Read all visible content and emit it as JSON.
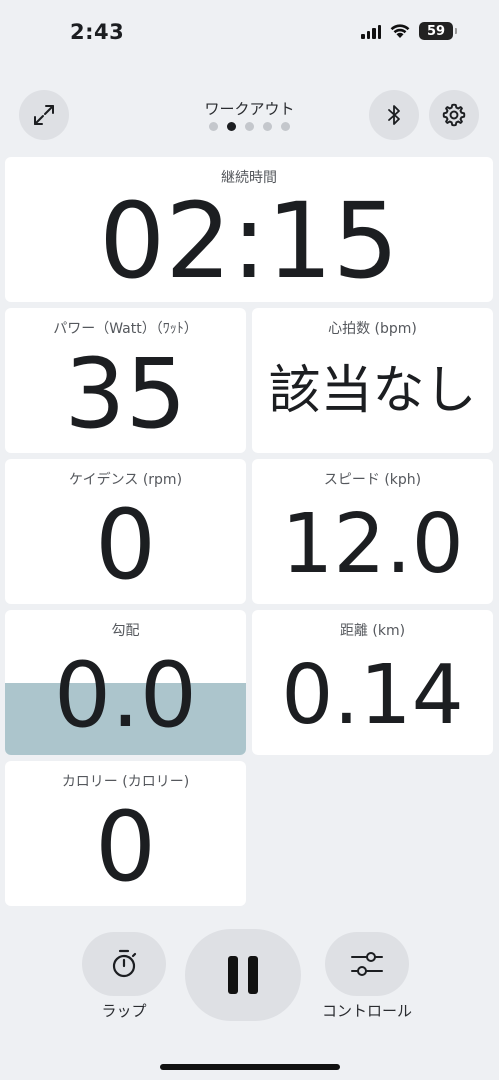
{
  "status_bar": {
    "time": "2:43",
    "battery": "59",
    "icons": [
      "signal-icon",
      "wifi-icon",
      "battery-icon"
    ]
  },
  "header": {
    "title": "ワークアウト",
    "page_count": 5,
    "active_page": 2,
    "left_button_icon": "expand-icon",
    "right_button_icons": [
      "bluetooth-icon",
      "gear-icon"
    ]
  },
  "metrics": {
    "duration": {
      "label": "継続時間",
      "value": "02:15"
    },
    "power": {
      "label": "パワー（Watt）（ﾜｯﾄ）",
      "value": "35"
    },
    "heart_rate": {
      "label": "心拍数 (bpm)",
      "value": "該当なし"
    },
    "cadence": {
      "label": "ケイデンス (rpm)",
      "value": "0"
    },
    "speed": {
      "label": "スピード (kph)",
      "value": "12.0"
    },
    "incline": {
      "label": "勾配",
      "value": "0.0",
      "fill_fraction": 0.5
    },
    "distance": {
      "label": "距離 (km)",
      "value": "0.14"
    },
    "calories": {
      "label": "カロリー (カロリー)",
      "value": "0"
    }
  },
  "controls": {
    "lap": {
      "label": "ラップ",
      "icon": "stopwatch-icon"
    },
    "pause": {
      "icon": "pause-icon"
    },
    "control": {
      "label": "コントロール",
      "icon": "sliders-icon"
    }
  },
  "colors": {
    "background": "#eef0f3",
    "tile": "#ffffff",
    "incline_fill": "#acc5cc",
    "button": "#dee0e4"
  }
}
